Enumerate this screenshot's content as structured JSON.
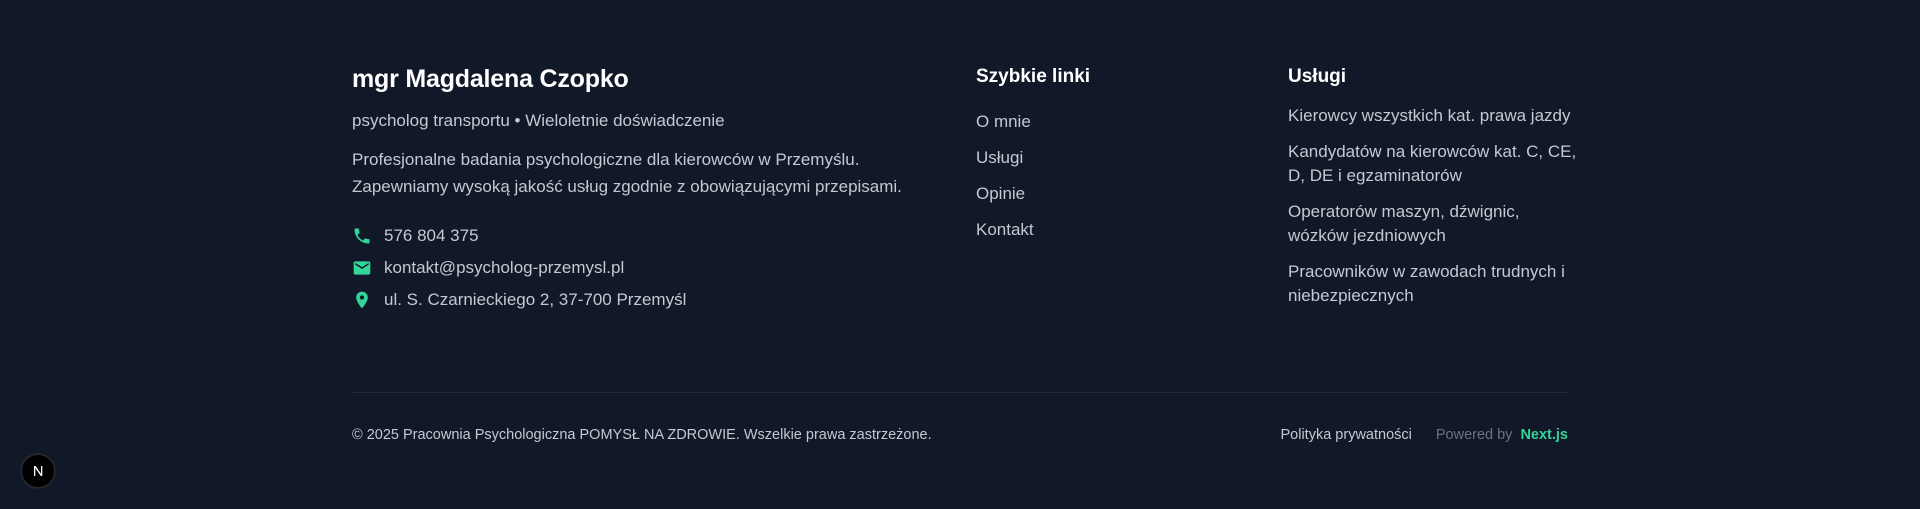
{
  "about": {
    "name": "mgr Magdalena Czopko",
    "tagline": "psycholog transportu • Wieloletnie doświadczenie",
    "description_line1": "Profesjonalne badania psychologiczne dla kierowców w Przemyślu.",
    "description_line2": "Zapewniamy wysoką jakość usług zgodnie z obowiązującymi przepisami.",
    "contacts": [
      {
        "icon": "phone-icon",
        "text": "576 804 375"
      },
      {
        "icon": "mail-icon",
        "text": "kontakt@psycholog-przemysl.pl"
      },
      {
        "icon": "map-pin-icon",
        "text": "ul. S. Czarnieckiego 2, 37-700 Przemyśl"
      }
    ]
  },
  "quick_links": {
    "heading": "Szybkie linki",
    "items": [
      "O mnie",
      "Usługi",
      "Opinie",
      "Kontakt"
    ]
  },
  "services": {
    "heading": "Usługi",
    "items": [
      "Kierowcy wszystkich kat. prawa jazdy",
      "Kandydatów na kierowców kat. C, CE, D, DE i egzaminatorów",
      "Operatorów maszyn, dźwignic, wózków jezdniowych",
      "Pracowników w zawodach trudnych i niebezpiecznych"
    ]
  },
  "bottom": {
    "copyright": "© 2025 Pracownia Psychologiczna POMYSŁ NA ZDROWIE. Wszelkie prawa zastrzeżone.",
    "privacy": "Polityka prywatności",
    "powered_by": "Powered by",
    "nextjs": "Next.js"
  },
  "colors": {
    "background": "#111827",
    "accent": "#34d399",
    "heading": "#ffffff",
    "text": "#c4c9d2"
  }
}
